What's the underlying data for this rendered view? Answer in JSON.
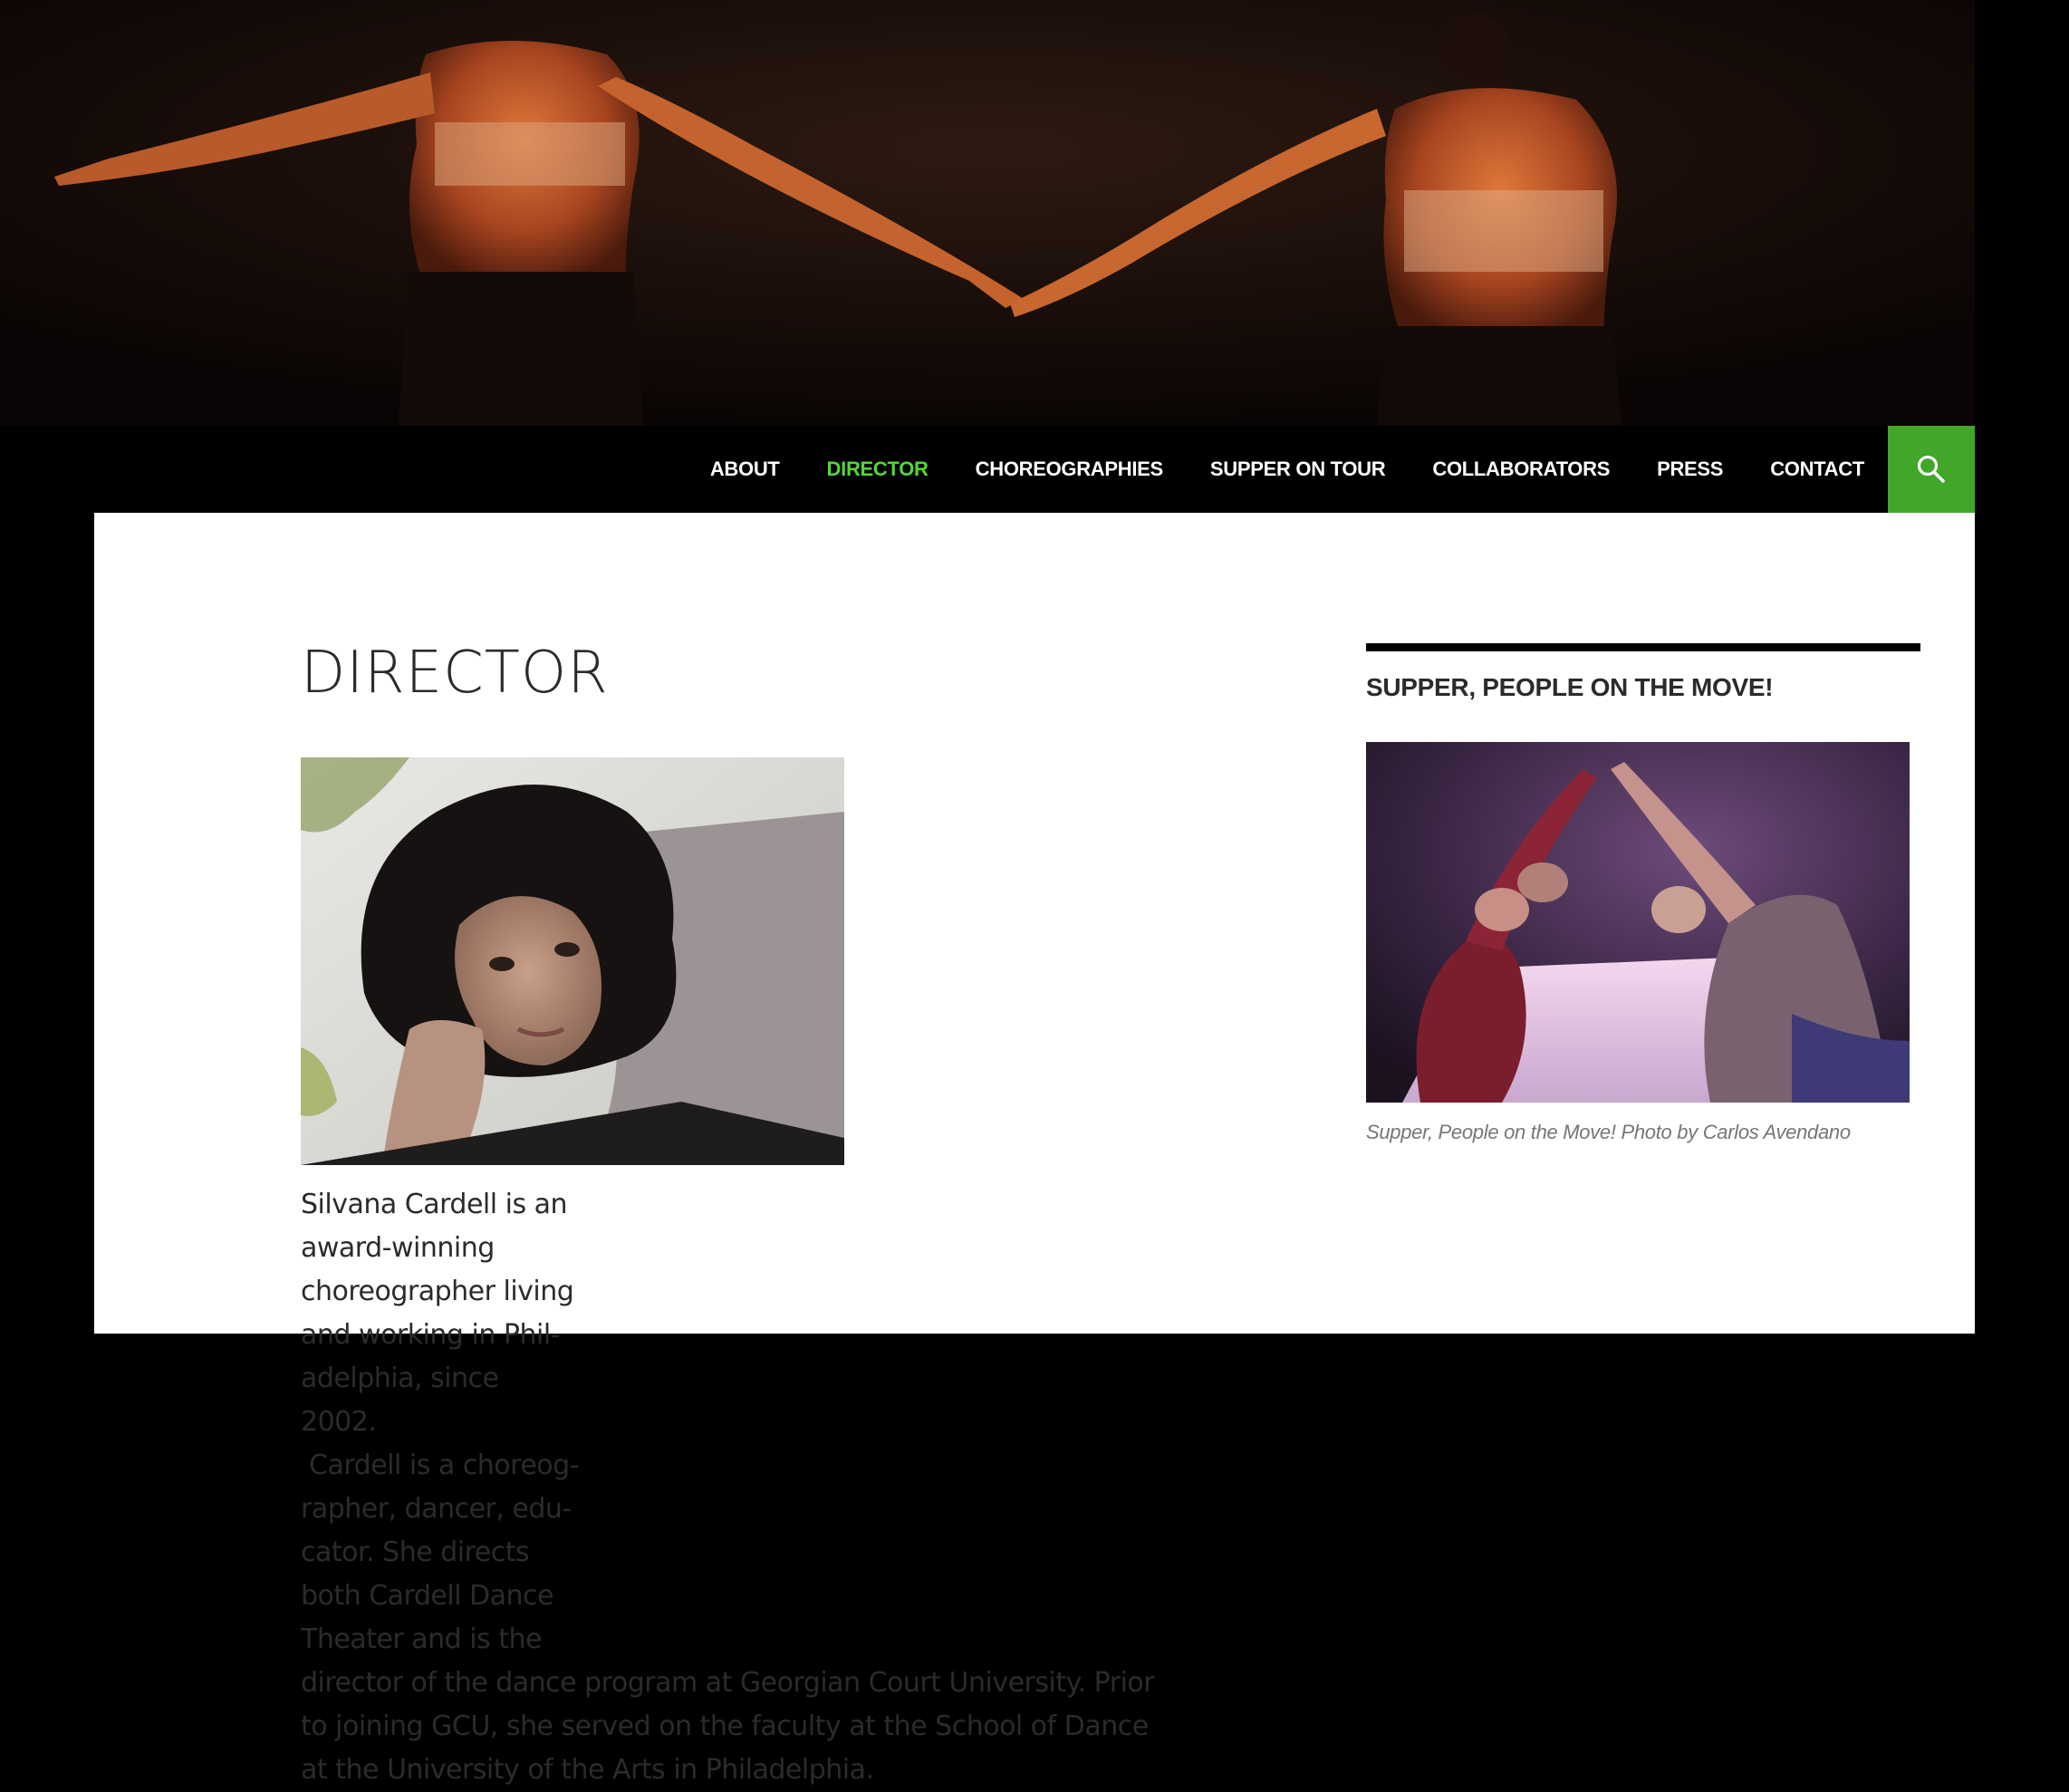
{
  "nav": {
    "items": [
      {
        "label": "ABOUT",
        "active": false
      },
      {
        "label": "DIRECTOR",
        "active": true
      },
      {
        "label": "CHOREOGRAPHIES",
        "active": false
      },
      {
        "label": "SUPPER ON TOUR",
        "active": false
      },
      {
        "label": "COLLABORATORS",
        "active": false
      },
      {
        "label": "PRESS",
        "active": false
      },
      {
        "label": "CONTACT",
        "active": false
      }
    ],
    "search_icon": "search-icon",
    "active_color": "#55d737",
    "search_bg": "#41a62a"
  },
  "page": {
    "title": "DIRECTOR",
    "bio_lines": [
      "Silvana Cardell is an",
      "award-winning",
      "choreographer living",
      "and working in Phil-",
      "adelphia, since 2002.",
      " Cardell is a choreog-",
      "rapher, dancer, edu-",
      "cator. She directs",
      "both Cardell Dance",
      "Theater and is the"
    ],
    "bio_rest": "director of the dance program at Georgian Court University. Prior to joining GCU, she served on the faculty at the School of Dance at the University of the Arts in Philadelphia."
  },
  "sidebar": {
    "widget_title": "SUPPER, PEOPLE ON THE MOVE!",
    "caption": "Supper, People on the Move! Photo by Carlos Avendano"
  }
}
